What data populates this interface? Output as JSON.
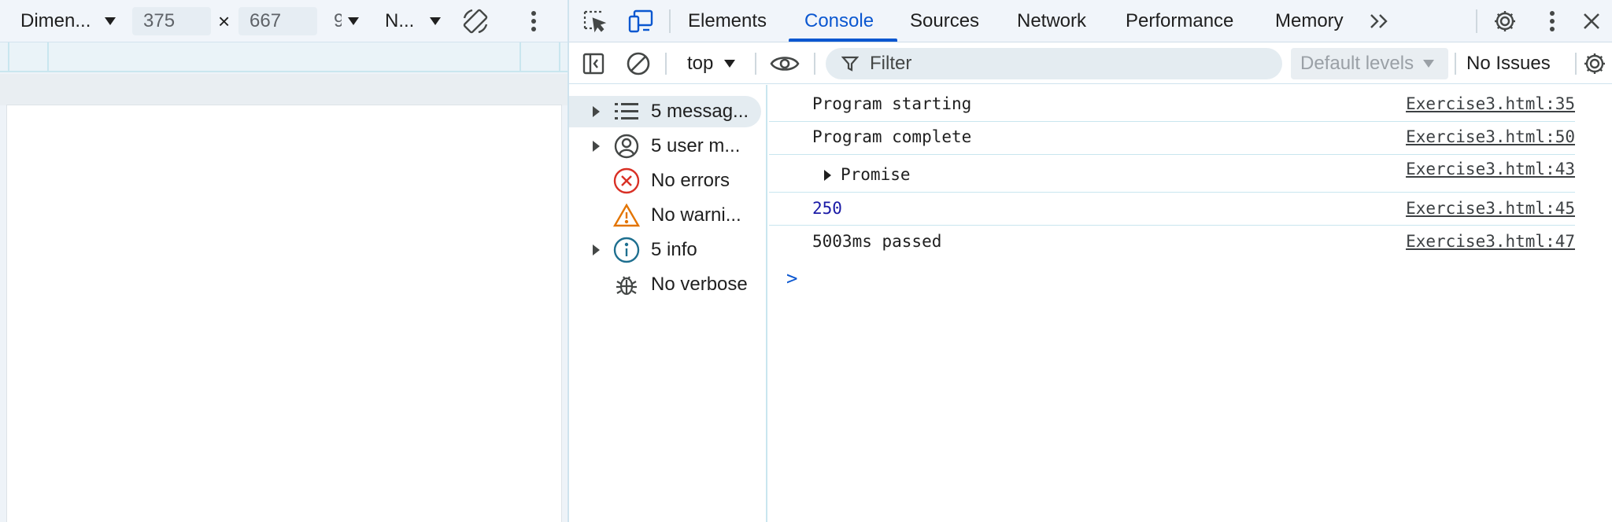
{
  "device_toolbar": {
    "dimensions_label": "Dimen...",
    "width_value": "375",
    "times_symbol": "×",
    "height_value": "667",
    "zoom_label": "9",
    "throttle_label": "N..."
  },
  "devtools_tabs": [
    {
      "label": "Elements",
      "active": false
    },
    {
      "label": "Console",
      "active": true
    },
    {
      "label": "Sources",
      "active": false
    },
    {
      "label": "Network",
      "active": false
    },
    {
      "label": "Performance",
      "active": false
    },
    {
      "label": "Memory",
      "active": false
    }
  ],
  "more_tabs_label": ">>",
  "console_toolbar": {
    "context_label": "top",
    "filter_placeholder": "Filter",
    "levels_label": "Default levels",
    "issues_label": "No Issues"
  },
  "sidebar": {
    "items": [
      {
        "label": "5 messag...",
        "icon": "list-icon",
        "expandable": true,
        "selected": true
      },
      {
        "label": "5 user m...",
        "icon": "user-icon",
        "expandable": true,
        "selected": false
      },
      {
        "label": "No errors",
        "icon": "error-icon",
        "expandable": false,
        "selected": false
      },
      {
        "label": "No warni...",
        "icon": "warning-icon",
        "expandable": false,
        "selected": false
      },
      {
        "label": "5 info",
        "icon": "info-icon",
        "expandable": true,
        "selected": false
      },
      {
        "label": "No verbose",
        "icon": "bug-icon",
        "expandable": false,
        "selected": false
      }
    ]
  },
  "messages": [
    {
      "text": "Program starting",
      "source": "Exercise3.html:35",
      "kind": "text"
    },
    {
      "text": "Program complete",
      "source": "Exercise3.html:50",
      "kind": "text"
    },
    {
      "text": "Promise",
      "source": "Exercise3.html:43",
      "kind": "object"
    },
    {
      "text": "250",
      "source": "Exercise3.html:45",
      "kind": "number"
    },
    {
      "text": "5003ms passed",
      "source": "Exercise3.html:47",
      "kind": "text"
    }
  ],
  "prompt_symbol": ">",
  "colors": {
    "accent": "#0b57d0",
    "error": "#d93025",
    "warning": "#e37400",
    "info": "#1a73e8",
    "number": "#1a1aa6"
  }
}
